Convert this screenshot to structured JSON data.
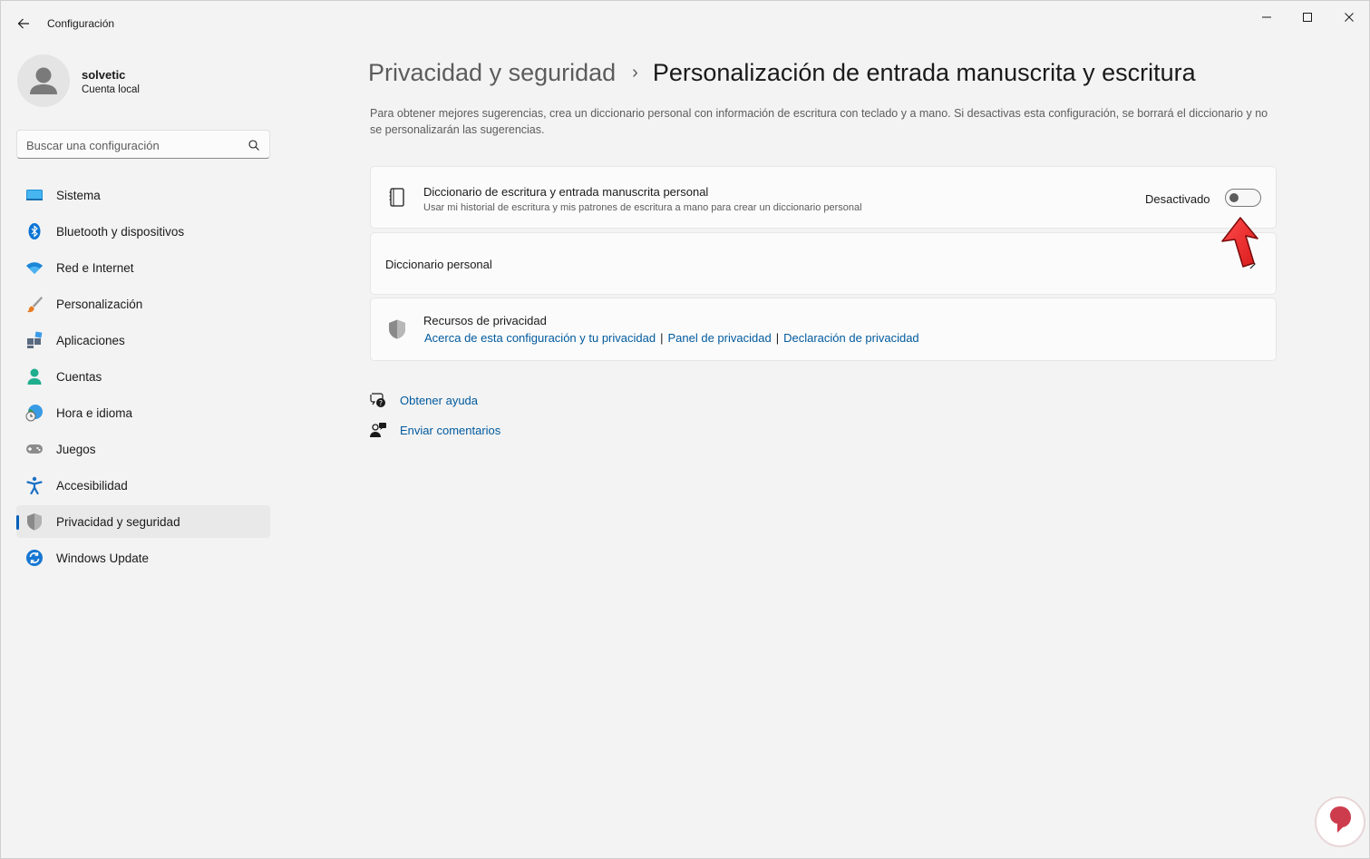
{
  "window": {
    "title": "Configuración"
  },
  "user": {
    "name": "solvetic",
    "account_type": "Cuenta local"
  },
  "search": {
    "placeholder": "Buscar una configuración"
  },
  "sidebar": {
    "items": [
      {
        "label": "Sistema",
        "icon": "system-icon"
      },
      {
        "label": "Bluetooth y dispositivos",
        "icon": "bluetooth-icon"
      },
      {
        "label": "Red e Internet",
        "icon": "wifi-icon"
      },
      {
        "label": "Personalización",
        "icon": "brush-icon"
      },
      {
        "label": "Aplicaciones",
        "icon": "apps-icon"
      },
      {
        "label": "Cuentas",
        "icon": "person-icon"
      },
      {
        "label": "Hora e idioma",
        "icon": "clock-globe-icon"
      },
      {
        "label": "Juegos",
        "icon": "gamepad-icon"
      },
      {
        "label": "Accesibilidad",
        "icon": "accessibility-icon"
      },
      {
        "label": "Privacidad y seguridad",
        "icon": "shield-icon",
        "selected": true
      },
      {
        "label": "Windows Update",
        "icon": "update-icon"
      }
    ],
    "accent_color": "#005fb8"
  },
  "breadcrumb": {
    "parent": "Privacidad y seguridad",
    "separator": "›",
    "current": "Personalización de entrada manuscrita y escritura"
  },
  "description": "Para obtener mejores sugerencias, crea un diccionario personal con información de escritura con teclado y a mano. Si desactivas esta configuración, se borrará el diccionario y no se personalizarán las sugerencias.",
  "cards": {
    "dictionary_setting": {
      "icon": "notebook-icon",
      "title": "Diccionario de escritura y entrada manuscrita personal",
      "subtitle": "Usar mi historial de escritura y mis patrones de escritura a mano para crear un diccionario personal",
      "toggle_state": "Desactivado",
      "toggle_on": false
    },
    "personal_dictionary": {
      "title": "Diccionario personal"
    },
    "privacy_resources": {
      "icon": "shield-icon",
      "title": "Recursos de privacidad",
      "links": [
        "Acerca de esta configuración y tu privacidad",
        "Panel de privacidad",
        "Declaración de privacidad"
      ]
    }
  },
  "help_links": {
    "get_help": "Obtener ayuda",
    "feedback": "Enviar comentarios"
  },
  "link_color": "#005a9e"
}
